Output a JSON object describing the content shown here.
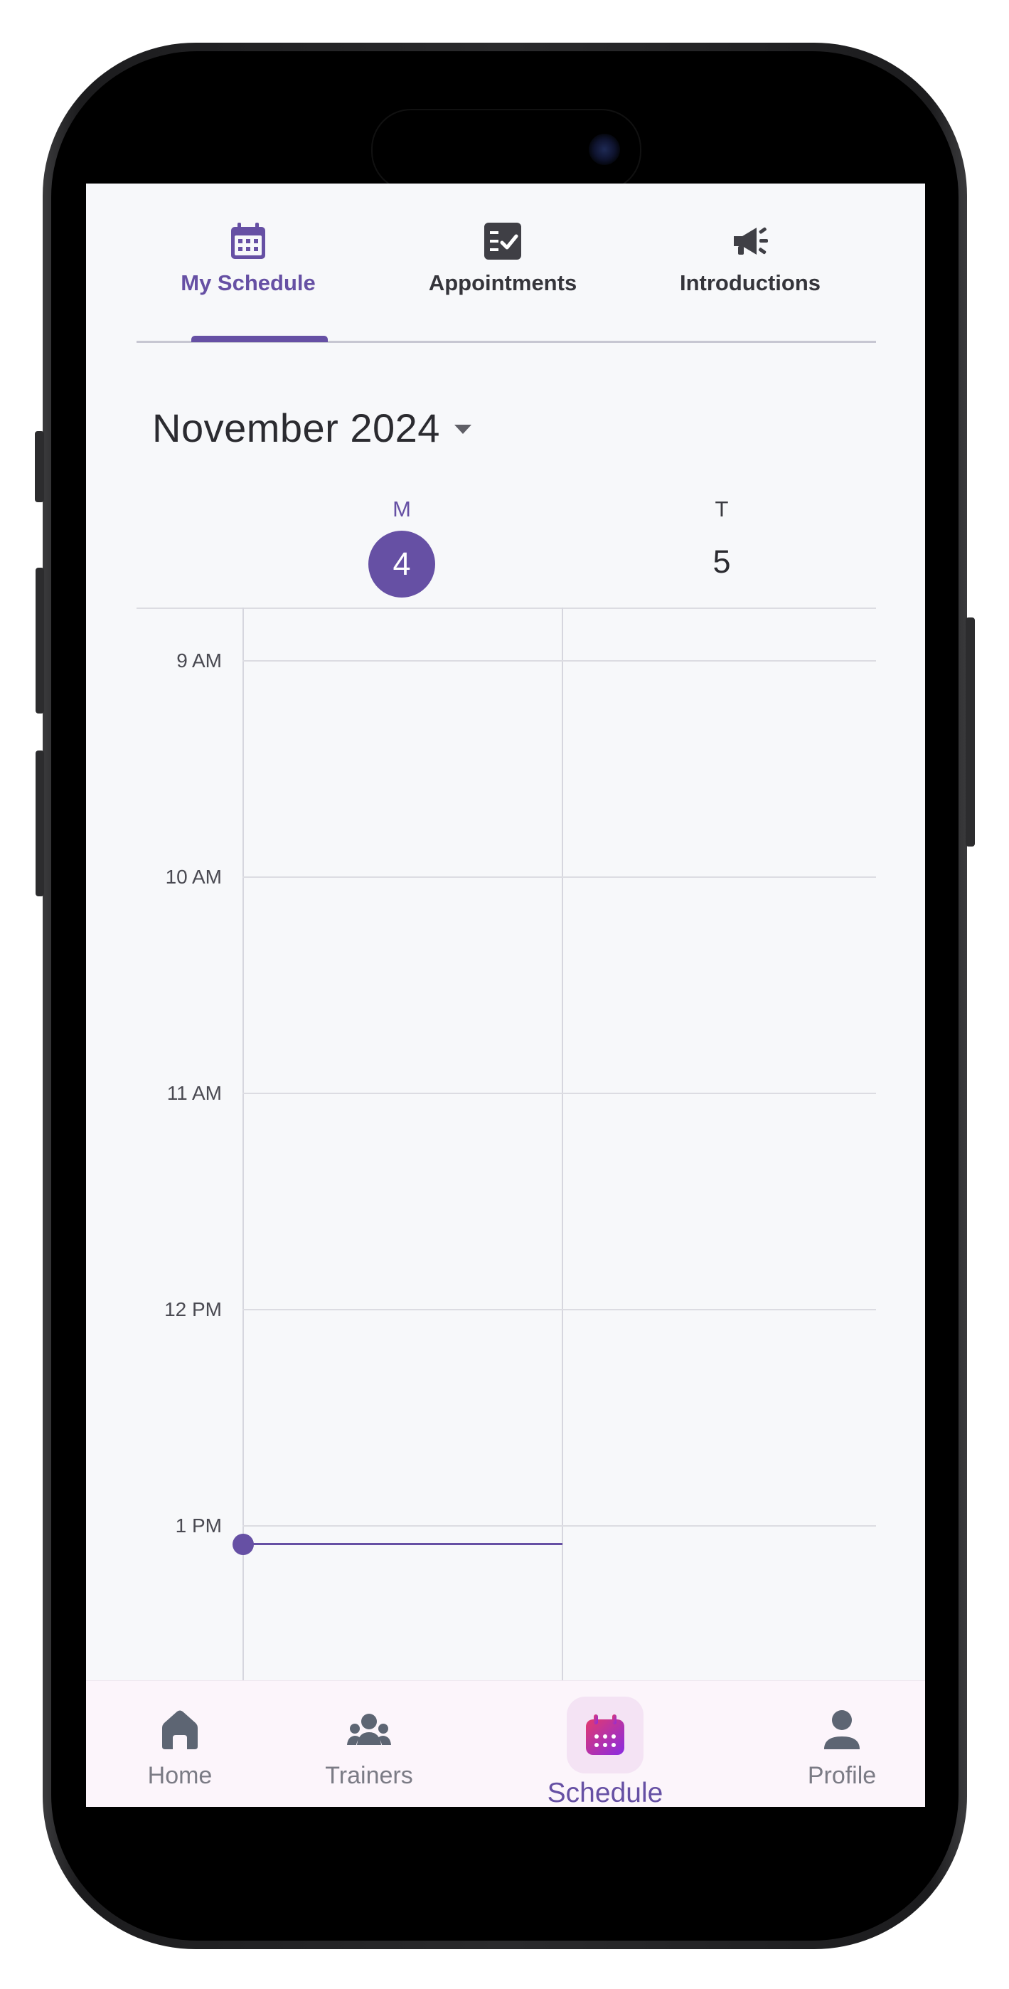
{
  "tabs": {
    "items": [
      {
        "label": "My Schedule",
        "icon": "calendar-icon",
        "active": true
      },
      {
        "label": "Appointments",
        "icon": "checklist-icon",
        "active": false
      },
      {
        "label": "Introductions",
        "icon": "megaphone-icon",
        "active": false
      }
    ]
  },
  "calendar": {
    "month": "November 2024",
    "days": [
      {
        "letter": "M",
        "number": "4",
        "selected": true
      },
      {
        "letter": "T",
        "number": "5",
        "selected": false
      }
    ],
    "time_labels": [
      "9 AM",
      "10 AM",
      "11 AM",
      "12 PM",
      "1 PM"
    ]
  },
  "bottom_nav": {
    "items": [
      {
        "label": "Home",
        "icon": "home-icon"
      },
      {
        "label": "Trainers",
        "icon": "group-icon"
      },
      {
        "label": "Schedule",
        "icon": "calendar-icon",
        "active": true
      },
      {
        "label": "Profile",
        "icon": "person-icon"
      }
    ]
  },
  "colors": {
    "accent": "#6650a4",
    "text_dark": "#2b2b30",
    "nav_background": "#fcf5fb",
    "screen_background": "#f7f8fa",
    "schedule_gradient_start": "#e23a6e",
    "schedule_gradient_end": "#8a2be2"
  }
}
